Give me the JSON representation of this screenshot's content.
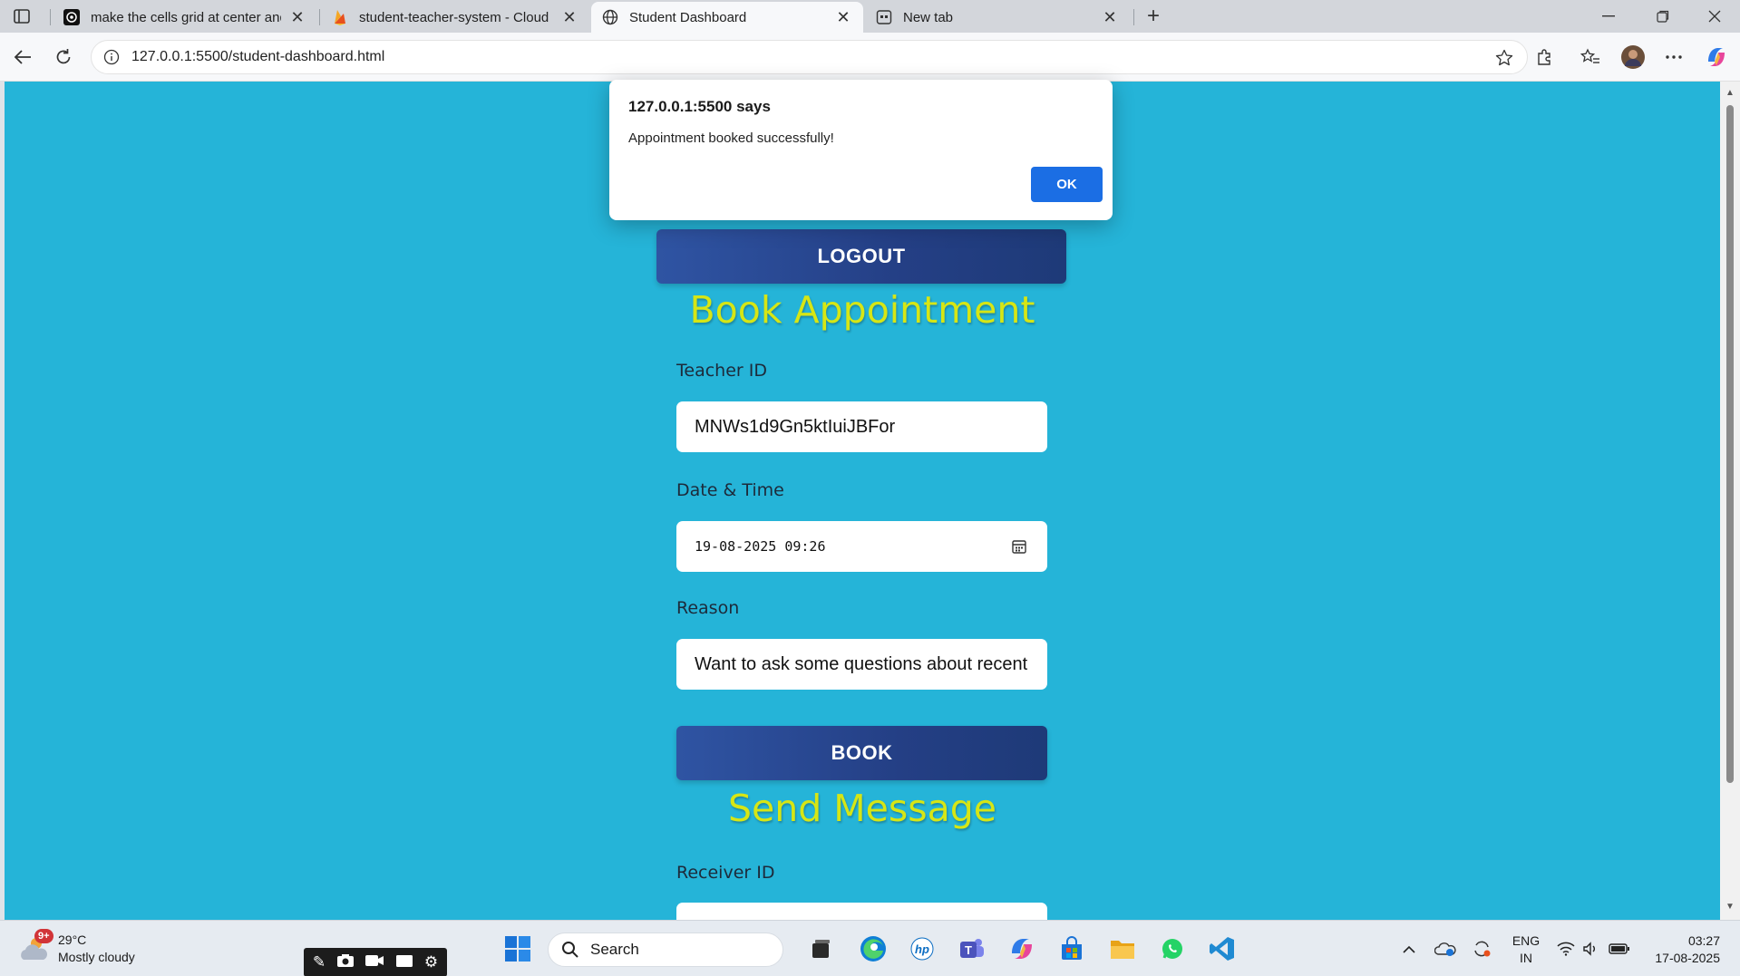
{
  "browser": {
    "tabs": [
      {
        "title": "make the cells grid at center and",
        "favicon": "chatgpt-icon",
        "active": false
      },
      {
        "title": "student-teacher-system - Cloud F",
        "favicon": "firebase-icon",
        "active": false
      },
      {
        "title": "Student Dashboard",
        "favicon": "globe-icon",
        "active": true
      },
      {
        "title": "New tab",
        "favicon": "newtab-icon",
        "active": false
      }
    ],
    "url": "127.0.0.1:5500/student-dashboard.html"
  },
  "dialog": {
    "title": "127.0.0.1:5500 says",
    "message": "Appointment booked successfully!",
    "ok_label": "OK"
  },
  "page": {
    "logout_label": "LOGOUT",
    "book_heading": "Book Appointment",
    "teacher_id_label": "Teacher ID",
    "teacher_id_value": "MNWs1d9Gn5ktIuiJBFor",
    "datetime_label": "Date & Time",
    "datetime_value": "19-08-2025 09:26",
    "reason_label": "Reason",
    "reason_value": "Want to ask some questions about recent",
    "book_label": "BOOK",
    "message_heading": "Send Message",
    "receiver_id_label": "Receiver ID"
  },
  "colors": {
    "page_background": "#25b4d8",
    "heading": "#d6e615",
    "button": "#2a4a95",
    "dialog_ok": "#1b6ee4"
  },
  "taskbar": {
    "weather_temp": "29°C",
    "weather_desc": "Mostly cloudy",
    "weather_badge": "9+",
    "search_label": "Search",
    "lang_line1": "ENG",
    "lang_line2": "IN",
    "time": "03:27",
    "date": "17-08-2025"
  }
}
